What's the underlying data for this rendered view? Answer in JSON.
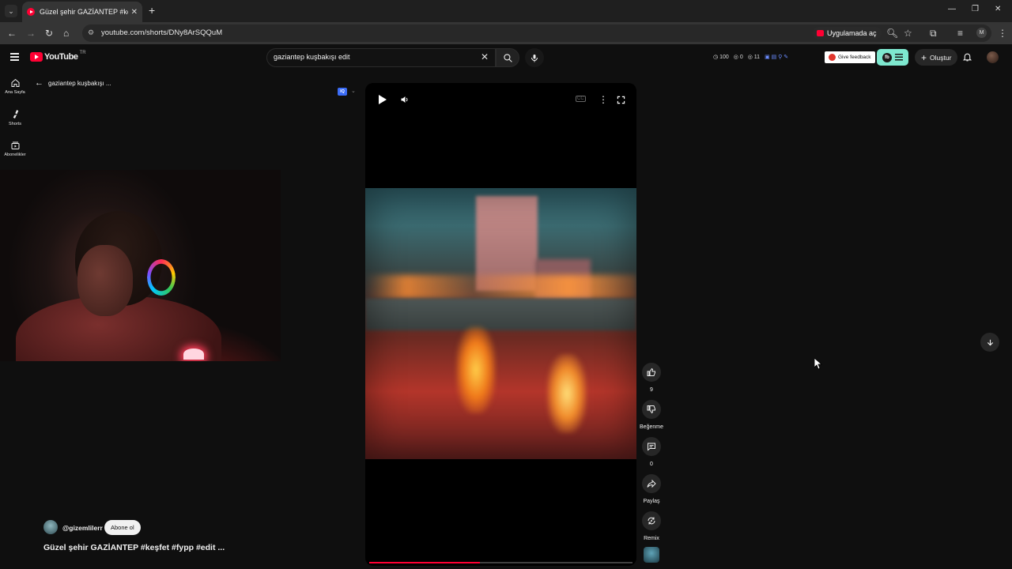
{
  "browser": {
    "tab_title": "Güzel şehir GAZİANTEP #keşfet",
    "url": "youtube.com/shorts/DNy8ArSQQuM",
    "open_in_app_label": "Uygulamada aç"
  },
  "masthead": {
    "logo_text": "YouTube",
    "country_code": "TR",
    "search_query": "gaziantep kuşbakışı edit",
    "stats": {
      "views": "100",
      "likes": "0",
      "comments": "11"
    },
    "feedback_label": "Give feedback",
    "create_label": "Oluştur"
  },
  "guide": {
    "items": [
      {
        "label": "Ana Sayfa",
        "icon": "home-icon"
      },
      {
        "label": "Shorts",
        "icon": "shorts-icon"
      },
      {
        "label": "Abonelikler",
        "icon": "subscriptions-icon"
      }
    ]
  },
  "back_row": {
    "label": "gaziantep kuşbakışı ..."
  },
  "player": {
    "state": "paused",
    "progress": 0.42,
    "extension_badge": "IQ"
  },
  "actions": {
    "like_count": "9",
    "dislike_label": "Beğenme",
    "comment_count": "0",
    "share_label": "Paylaş",
    "remix_label": "Remix"
  },
  "channel": {
    "handle": "@gizemlilerr",
    "subscribe_label": "Abone ol"
  },
  "video": {
    "title": "Güzel şehir GAZİANTEP #keşfet #fypp #edit ..."
  },
  "colors": {
    "accent": "#ff0033",
    "background": "#0f0f0f",
    "extension_accent": "#7ee8cf"
  }
}
